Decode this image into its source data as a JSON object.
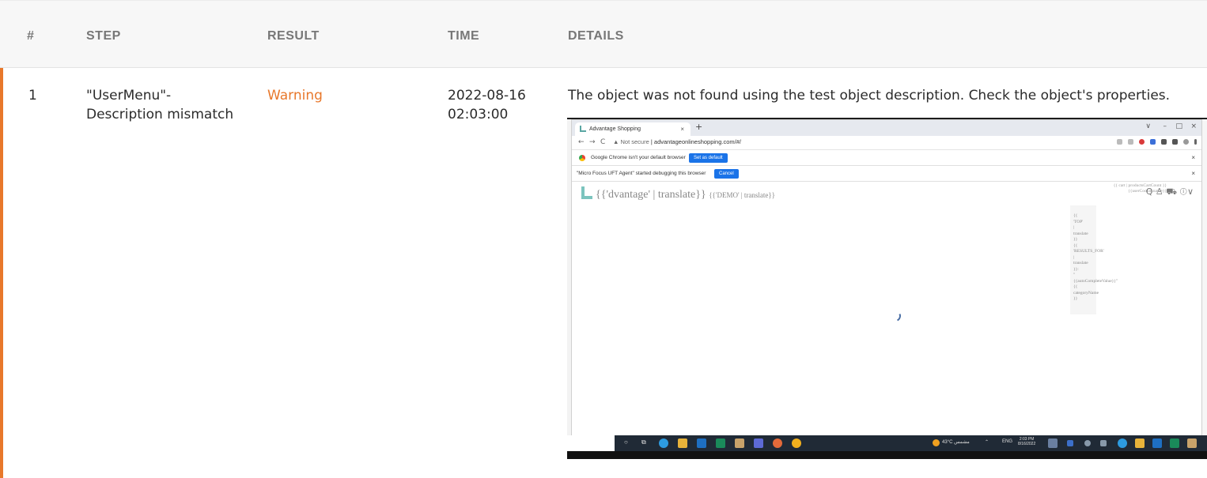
{
  "table": {
    "headers": {
      "num": "#",
      "step": "STEP",
      "result": "RESULT",
      "time": "TIME",
      "details": "DETAILS"
    },
    "rows": [
      {
        "num": "1",
        "step_line1": "\"UserMenu\"-",
        "step_line2": "Description mismatch",
        "result": "Warning",
        "time_line1": "2022-08-16",
        "time_line2": "02:03:00",
        "details": "The object was not found using the test object description. Check the object's properties."
      }
    ]
  },
  "screenshot": {
    "tab_title": "Advantage Shopping",
    "tab_close": "×",
    "new_tab": "+",
    "window_controls": [
      "∨",
      "–",
      "□",
      "×"
    ],
    "nav": [
      "←",
      "→",
      "C"
    ],
    "url_warning": "▲ Not secure",
    "url": "advantageonlineshopping.com/#/",
    "infobar1_text": "Google Chrome isn't your default browser",
    "infobar1_button": "Set as default",
    "infobar2_text": "\"Micro Focus UFT Agent\" started debugging this browser",
    "infobar2_button": "Cancel",
    "infobar_close": "×",
    "logo_text": "{{'dvantage' | translate}}",
    "logo_small": "{{'DEMO' | translate}}",
    "header_icons": "Q  ♙          ⛟  ⓘ∨",
    "cart_tip_line1": "{{ cart | productsCartCount }}",
    "cart_tip_line2": "{{userCookie.name}}",
    "dropdown_text": "{{\n'TOP'\n|\ntranslate\n}}\n{{\n'RESULTS_FOR'\n|\ntranslate\n}}:\n\"\n{{autoCompleteValue}}\"\n{{\ncategoryName\n}}",
    "weather": "43°C مشمس",
    "lang": "ENG",
    "clock_time": "2:03 PM",
    "clock_date": "8/16/2022"
  },
  "colors": {
    "accent": "#e8782b",
    "header_bg": "#f7f7f7",
    "header_text": "#777777"
  }
}
